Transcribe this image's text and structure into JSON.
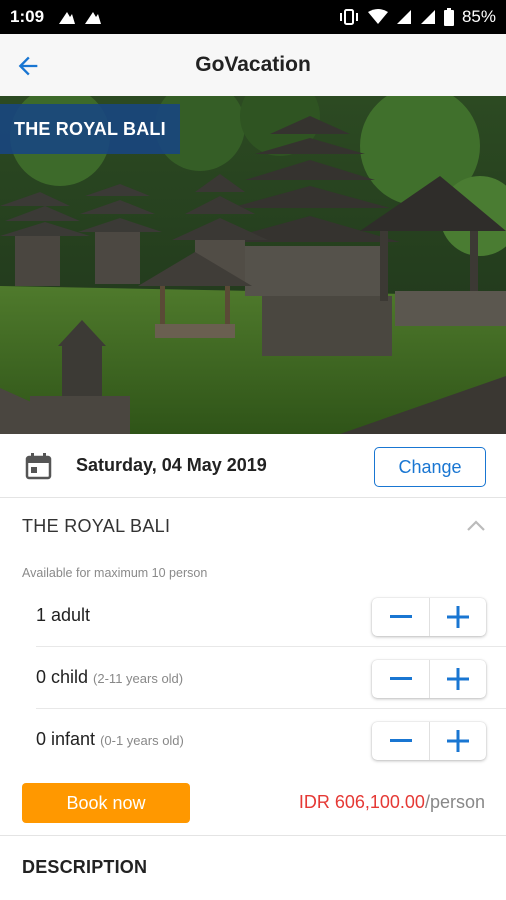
{
  "status_bar": {
    "time": "1:09",
    "battery": "85%",
    "icons": [
      "notification-icon",
      "notification-icon",
      "vibrate-icon",
      "wifi-icon",
      "signal-icon",
      "signal-icon",
      "battery-icon"
    ]
  },
  "app_bar": {
    "title": "GoVacation",
    "back_icon": "arrow-back-icon"
  },
  "hero": {
    "badge": "THE ROYAL BALI"
  },
  "date_row": {
    "icon": "calendar-icon",
    "date": "Saturday, 04 May 2019",
    "change_label": "Change"
  },
  "package": {
    "title": "THE ROYAL BALI",
    "collapse_icon": "chevron-up-icon",
    "availability": "Available for maximum 10 person",
    "participants": [
      {
        "label": "1 adult",
        "note": ""
      },
      {
        "label": "0 child",
        "note": "(2-11 years old)"
      },
      {
        "label": "0 infant",
        "note": "(0-1 years old)"
      }
    ],
    "book_label": "Book now",
    "price": "IDR 606,100.00",
    "price_unit": "/person"
  },
  "description": {
    "heading": "DESCRIPTION"
  },
  "colors": {
    "accent": "#1976d2",
    "book": "#ff9800",
    "price": "#e53935",
    "badge": "#184682"
  }
}
